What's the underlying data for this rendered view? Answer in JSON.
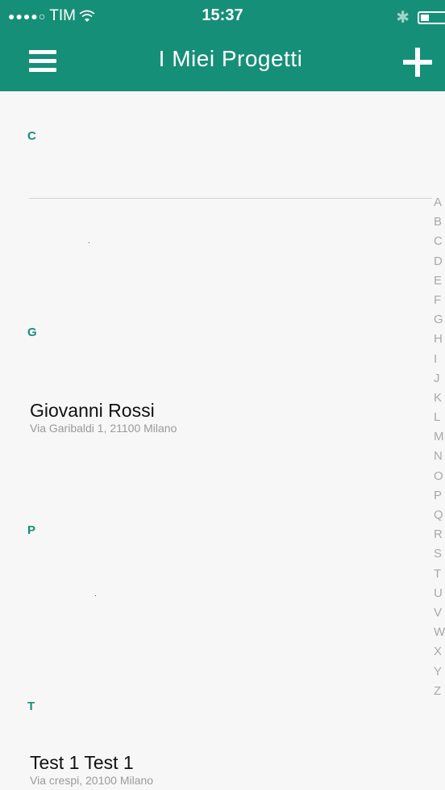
{
  "status_bar": {
    "signal_dots": "●●●●○",
    "carrier": "TIM",
    "wifi_icon": "wifi-icon",
    "time": "15:37",
    "bluetooth_icon": "bluetooth-icon",
    "battery_icon": "battery-icon"
  },
  "nav": {
    "title": "I Miei Progetti",
    "menu_icon": "hamburger-icon",
    "add_icon": "plus-icon"
  },
  "colors": {
    "accent": "#168f78",
    "background": "#f7f7f7",
    "index_text": "#a8a8a8",
    "subtitle_text": "#9a9a9a"
  },
  "sections": [
    {
      "letter": "C",
      "items": []
    },
    {
      "letter": "G",
      "items": [
        {
          "title": "Giovanni Rossi",
          "subtitle": "Via Garibaldi 1, 21100 Milano"
        }
      ]
    },
    {
      "letter": "P",
      "items": []
    },
    {
      "letter": "T",
      "items": [
        {
          "title": "Test 1 Test 1",
          "subtitle": "Via crespi, 20100 Milano"
        }
      ]
    }
  ],
  "index_letters": [
    "A",
    "B",
    "C",
    "D",
    "E",
    "F",
    "G",
    "H",
    "I",
    "J",
    "K",
    "L",
    "M",
    "N",
    "O",
    "P",
    "Q",
    "R",
    "S",
    "T",
    "U",
    "V",
    "W",
    "X",
    "Y",
    "Z"
  ]
}
